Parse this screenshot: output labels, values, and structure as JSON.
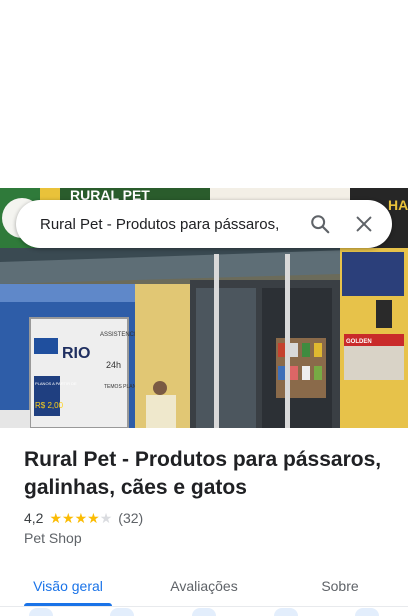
{
  "search": {
    "query": "Rural Pet - Produtos para pássaros,",
    "search_icon": "search-icon",
    "close_icon": "close-icon"
  },
  "photo": {
    "storefront_sign": "RURAL PET",
    "sign_right": "HA D",
    "door_sign_brand": "RIO",
    "door_sign_line1": "ASSISTENCIA FUNERAL",
    "door_sign_line2": "24h",
    "door_sign_plan": "PLANOS A PARTIR DE",
    "door_sign_price": "R$ 2,00",
    "door_sign_terms": "TEMOS PLANOS FIXOS",
    "banner_right": "GOLDEN"
  },
  "place": {
    "title": "Rural Pet - Produtos para pássaros, galinhas, cães e gatos",
    "rating": "4,2",
    "stars_filled": 4,
    "review_count": "(32)",
    "category": "Pet Shop"
  },
  "tabs": [
    {
      "label": "Visão geral",
      "active": true
    },
    {
      "label": "Avaliações",
      "active": false
    },
    {
      "label": "Sobre",
      "active": false
    }
  ],
  "colors": {
    "accent": "#1a73e8",
    "star": "#fbbc04",
    "text_primary": "#202124",
    "text_secondary": "#5f6368"
  }
}
